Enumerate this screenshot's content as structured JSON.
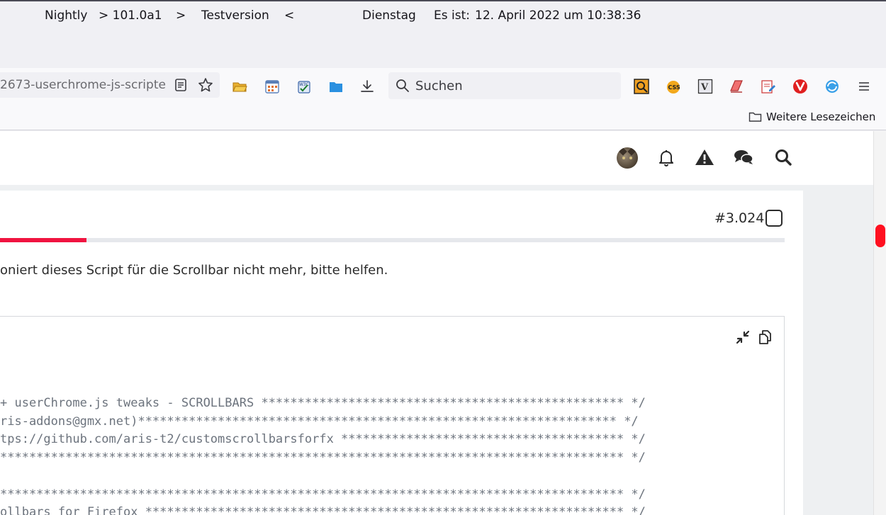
{
  "titlebar": {
    "app_name": "Nightly",
    "version": "> 101.0a1",
    "sep1": ">",
    "channel": "Testversion",
    "sep2": "<",
    "weekday": "Dienstag",
    "time_label": "Es ist:",
    "datetime": "12. April 2022 um 10:38:36"
  },
  "toolbar": {
    "url": "2673-userchrome-js-scripte",
    "search_placeholder": "Suchen"
  },
  "bookmarks": {
    "more_bookmarks_label": "Weitere Lesezeichen"
  },
  "post": {
    "number": "#3.024",
    "read_progress": 0.11,
    "text": "oniert dieses Script für die Scrollbar nicht mehr, bitte helfen.",
    "code_lines": [
      "+ userChrome.js tweaks - SCROLLBARS ************************************************** */",
      "ris-addons@gmx.net)****************************************************************** */",
      "tps://github.com/aris-t2/customscrollbarsforfx *************************************** */",
      "************************************************************************************** */",
      "",
      "************************************************************************************** */",
      "ollbars for Firefox ****************************************************************** */"
    ]
  },
  "colors": {
    "accent": "#f01440",
    "scrollbar_thumb": "#ff1020"
  }
}
